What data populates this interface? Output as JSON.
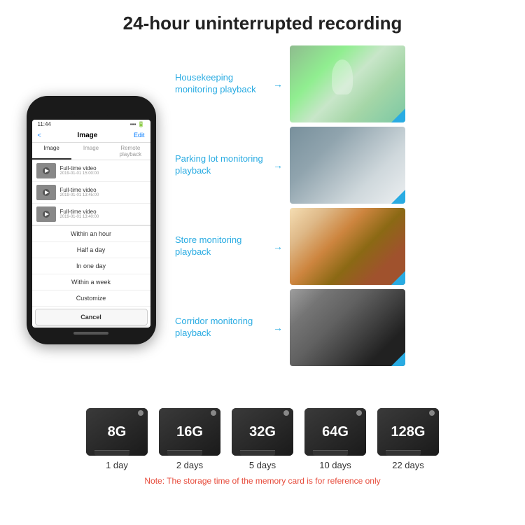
{
  "header": {
    "title": "24-hour uninterrupted recording"
  },
  "phone": {
    "time": "11:44",
    "nav": {
      "back": "<",
      "title": "Image",
      "edit": "Edit"
    },
    "tabs": [
      "Image",
      "Image",
      "Remote playback"
    ],
    "list_items": [
      {
        "title": "Full-time video",
        "subtitle": "2019-01-01 15:00:00"
      },
      {
        "title": "Full-time video",
        "subtitle": "2019-01-01 13:45:00"
      },
      {
        "title": "Full-time video",
        "subtitle": "2019-01-01 13:40:00"
      }
    ],
    "dropdown_items": [
      "Within an hour",
      "Half a day",
      "In one day",
      "Within a week",
      "Customize"
    ],
    "cancel_label": "Cancel"
  },
  "monitoring": [
    {
      "label": "Housekeeping monitoring playback",
      "img_class": "img-housekeeping"
    },
    {
      "label": "Parking lot monitoring playback",
      "img_class": "img-parking"
    },
    {
      "label": "Store monitoring playback",
      "img_class": "img-store"
    },
    {
      "label": "Corridor monitoring playback",
      "img_class": "img-corridor"
    }
  ],
  "storage": {
    "cards": [
      {
        "size": "8G",
        "days": "1 day"
      },
      {
        "size": "16G",
        "days": "2 days"
      },
      {
        "size": "32G",
        "days": "5 days"
      },
      {
        "size": "64G",
        "days": "10 days"
      },
      {
        "size": "128G",
        "days": "22 days"
      }
    ],
    "note": "Note: The storage time of the memory card is for reference only"
  }
}
